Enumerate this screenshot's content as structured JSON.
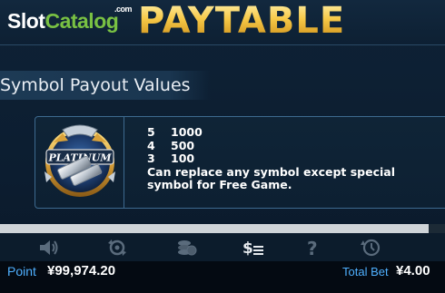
{
  "header": {
    "logo_slot": "Slot",
    "logo_catalog": "Catalog",
    "logo_com": ".com",
    "title": "PAYTABLE"
  },
  "section": {
    "title": "Symbol Payout Values"
  },
  "symbol": {
    "icon_name": "platinum-symbol-icon",
    "logo_text": "PLATINUM",
    "payouts": [
      {
        "count": "5",
        "value": "1000"
      },
      {
        "count": "4",
        "value": "500"
      },
      {
        "count": "3",
        "value": "100"
      }
    ],
    "description": "Can replace any symbol except special symbol for Free Game."
  },
  "scrollbar": {
    "position_fraction": 0.96
  },
  "toolbar": {
    "icons": [
      "sound-icon",
      "autoplay-icon",
      "coins-icon",
      "paytable-icon",
      "help-icon",
      "history-icon"
    ]
  },
  "footer": {
    "point_label": "Point",
    "point_value": "¥99,974.20",
    "bet_label": "Total Bet",
    "bet_value": "¥4.00"
  },
  "colors": {
    "gold": "#f5c542",
    "accent_blue": "#4fb0ff",
    "logo_green": "#79c143",
    "card_border": "#3d6a8f"
  }
}
